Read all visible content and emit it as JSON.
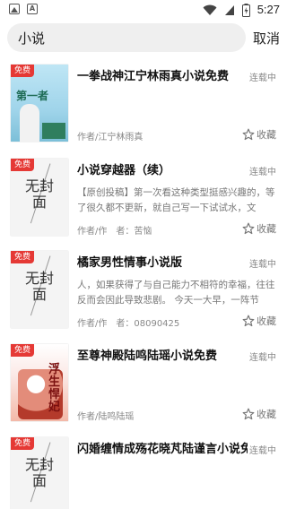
{
  "status_bar": {
    "time": "5:27"
  },
  "search": {
    "query": "小说",
    "cancel_label": "取消"
  },
  "items": [
    {
      "badge": "免费",
      "cover_text": "",
      "cover_style": "sky",
      "cover_lettering": "第一者",
      "title": "一拳战神江宁林雨真小说免费",
      "status": "连载中",
      "description": "",
      "author": "作者/江宁林雨真",
      "fav_label": "收藏"
    },
    {
      "badge": "免费",
      "cover_text": "无封面",
      "cover_style": "blank",
      "title": "小说穿越器（续）",
      "status": "连载中",
      "description": "【原创投稿】第一次看这种类型挺感兴趣的，等了很久都不更新，就自己写一下试试水，文",
      "author": "作者/作　者：苦恼",
      "fav_label": "收藏"
    },
    {
      "badge": "免费",
      "cover_text": "无封面",
      "cover_style": "blank",
      "title": "橘家男性情事小说版",
      "status": "连载中",
      "description": "人，如果获得了与自己能力不相符的幸福，往往反而会因此导致悲剧。 今天一大早，一阵节",
      "author": "作者/作　者：08090425",
      "fav_label": "收藏"
    },
    {
      "badge": "免费",
      "cover_text": "",
      "cover_style": "red",
      "cover_lettering": "浮生悍妃",
      "title": "至尊神殿陆鸣陆瑶小说免费",
      "status": "连载中",
      "description": "",
      "author": "作者/陆鸣陆瑶",
      "fav_label": "收藏"
    },
    {
      "badge": "免费",
      "cover_text": "无封面",
      "cover_style": "blank",
      "title": "闪婚缠情成殇花晓芃陆谨言小说免费",
      "status": "连载中",
      "description": "",
      "author": "",
      "fav_label": ""
    }
  ]
}
